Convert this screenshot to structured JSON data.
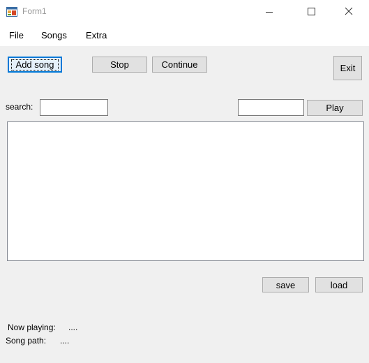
{
  "window": {
    "title": "Form1"
  },
  "menu": {
    "items": [
      "File",
      "Songs",
      "Extra"
    ]
  },
  "buttons": {
    "add_song": "Add song",
    "stop": "Stop",
    "continue": "Continue",
    "exit": "Exit",
    "play": "Play",
    "save": "save",
    "load": "load"
  },
  "search": {
    "label": "search:",
    "value": ""
  },
  "play_input": {
    "value": ""
  },
  "status": {
    "now_playing_label": "Now playing:",
    "now_playing_value": "....",
    "song_path_label": "Song path:",
    "song_path_value": "...."
  },
  "icons": {
    "app": "windows-form-icon",
    "minimize": "minimize-icon",
    "maximize": "maximize-icon",
    "close": "close-icon"
  }
}
